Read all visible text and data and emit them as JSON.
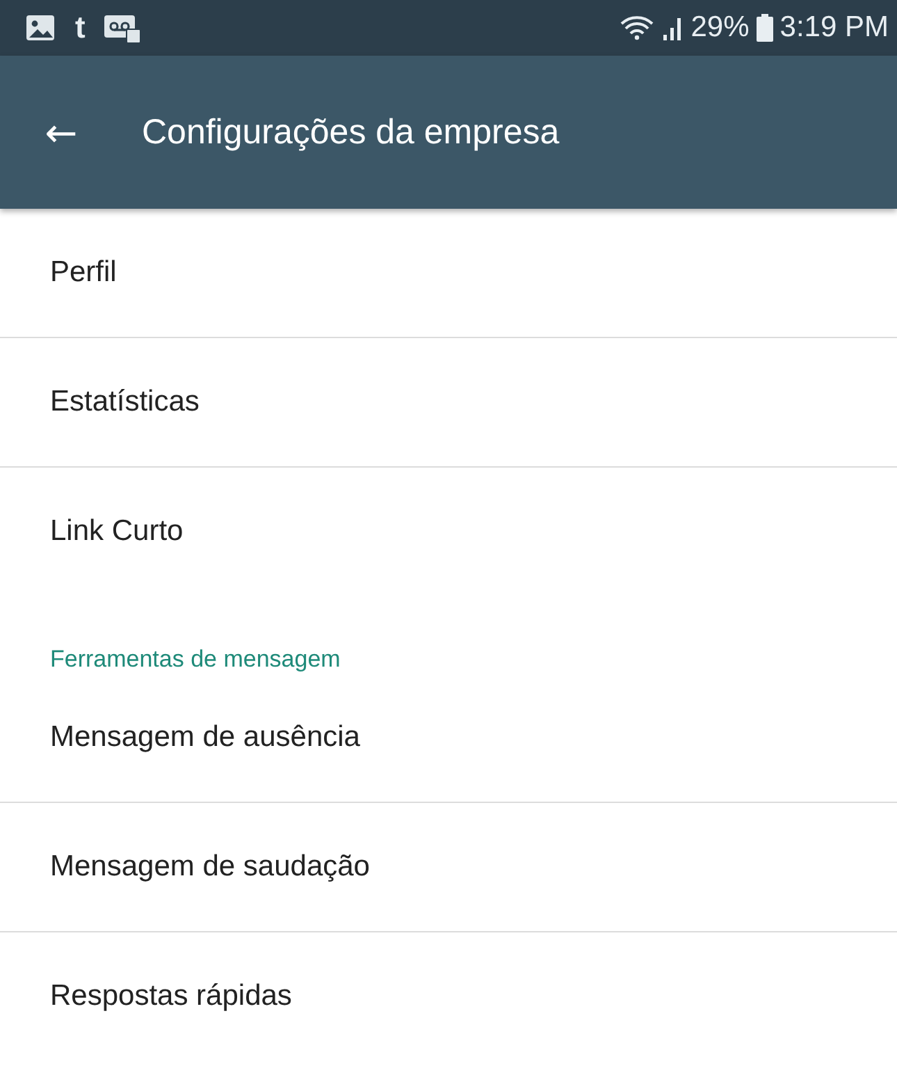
{
  "status_bar": {
    "app_glyph": "t",
    "battery_percent": "29%",
    "time": "3:19 PM"
  },
  "app_bar": {
    "back_glyph": "←",
    "title": "Configurações da empresa"
  },
  "sections": [
    {
      "items": [
        "Perfil",
        "Estatísticas",
        "Link Curto"
      ]
    },
    {
      "header": "Ferramentas de mensagem",
      "items": [
        "Mensagem de ausência",
        "Mensagem de saudação",
        "Respostas rápidas"
      ]
    }
  ]
}
